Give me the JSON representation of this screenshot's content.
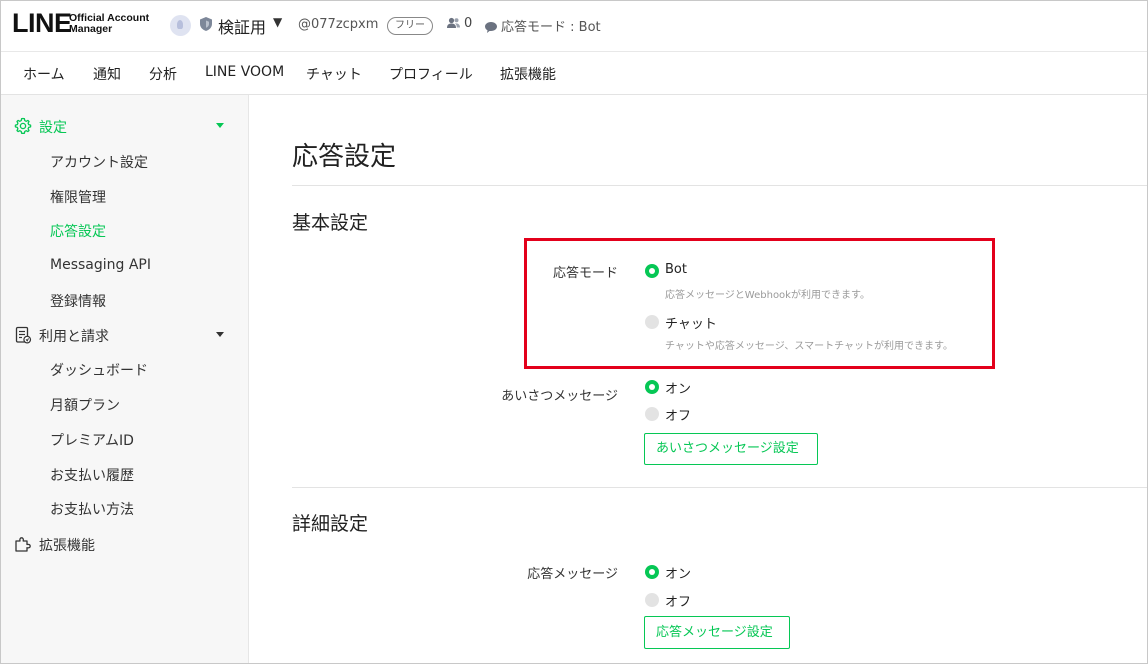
{
  "header": {
    "logo_main": "LINE",
    "logo_sub_1": "Official Account",
    "logo_sub_2": "Manager",
    "account_name": "検証用",
    "account_id": "@077zcpxm",
    "plan_badge": "フリー",
    "followers_count": "0",
    "response_mode_indicator": "応答モード : Bot"
  },
  "nav": {
    "items": [
      "ホーム",
      "通知",
      "分析",
      "LINE VOOM",
      "チャット",
      "プロフィール",
      "拡張機能"
    ]
  },
  "sidebar": {
    "settings_group": {
      "label": "設定",
      "items": [
        "アカウント設定",
        "権限管理",
        "応答設定",
        "Messaging API",
        "登録情報"
      ]
    },
    "billing_group": {
      "label": "利用と請求",
      "items": [
        "ダッシュボード",
        "月額プラン",
        "プレミアムID",
        "お支払い履歴",
        "お支払い方法"
      ]
    },
    "extensions_label": "拡張機能"
  },
  "main": {
    "page_title": "応答設定",
    "basic_section": {
      "title": "基本設定",
      "response_mode": {
        "label": "応答モード",
        "selected": "Bot",
        "options": [
          {
            "label": "Bot",
            "desc": "応答メッセージとWebhookが利用できます。"
          },
          {
            "label": "チャット",
            "desc": "チャットや応答メッセージ、スマートチャットが利用できます。"
          }
        ]
      },
      "greeting": {
        "label": "あいさつメッセージ",
        "selected": "オン",
        "on_label": "オン",
        "off_label": "オフ",
        "button": "あいさつメッセージ設定"
      }
    },
    "detail_section": {
      "title": "詳細設定",
      "auto_reply": {
        "label": "応答メッセージ",
        "selected": "オン",
        "on_label": "オン",
        "off_label": "オフ",
        "button": "応答メッセージ設定"
      }
    }
  },
  "colors": {
    "accent": "#06c755",
    "highlight": "#e3001b"
  }
}
